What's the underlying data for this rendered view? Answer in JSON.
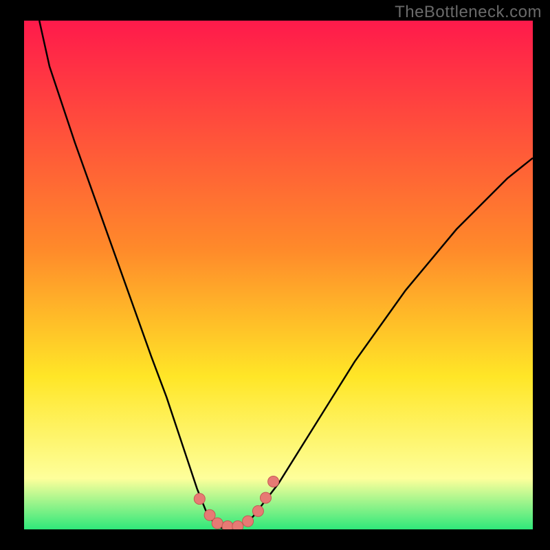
{
  "watermark": "TheBottleneck.com",
  "colors": {
    "gradient_top": "#ff1a4b",
    "gradient_mid1": "#ff8a2a",
    "gradient_mid2": "#ffe627",
    "gradient_mid3": "#feff9b",
    "gradient_bottom": "#2fe87a",
    "bg": "#000000",
    "curve": "#000000",
    "marker_fill": "#e77a74",
    "marker_stroke": "#c55853"
  },
  "chart_data": {
    "type": "line",
    "title": "",
    "xlabel": "",
    "ylabel": "",
    "xlim": [
      0,
      100
    ],
    "ylim": [
      0,
      100
    ],
    "x": [
      3,
      5,
      10,
      15,
      20,
      25,
      28,
      30,
      32,
      34,
      36,
      38,
      40,
      42,
      45,
      50,
      55,
      60,
      65,
      70,
      75,
      80,
      85,
      90,
      95,
      100
    ],
    "values": [
      100,
      91,
      76,
      62,
      48,
      34,
      26,
      20,
      14,
      8,
      3,
      0.5,
      0,
      0.5,
      2.5,
      9,
      17,
      25,
      33,
      40,
      47,
      53,
      59,
      64,
      69,
      73
    ],
    "markers": {
      "x": [
        34.5,
        36.5,
        38,
        40,
        42,
        44,
        46,
        47.5,
        49
      ],
      "y": [
        6,
        2.8,
        1.2,
        0.6,
        0.6,
        1.6,
        3.6,
        6.2,
        9.4
      ]
    }
  }
}
